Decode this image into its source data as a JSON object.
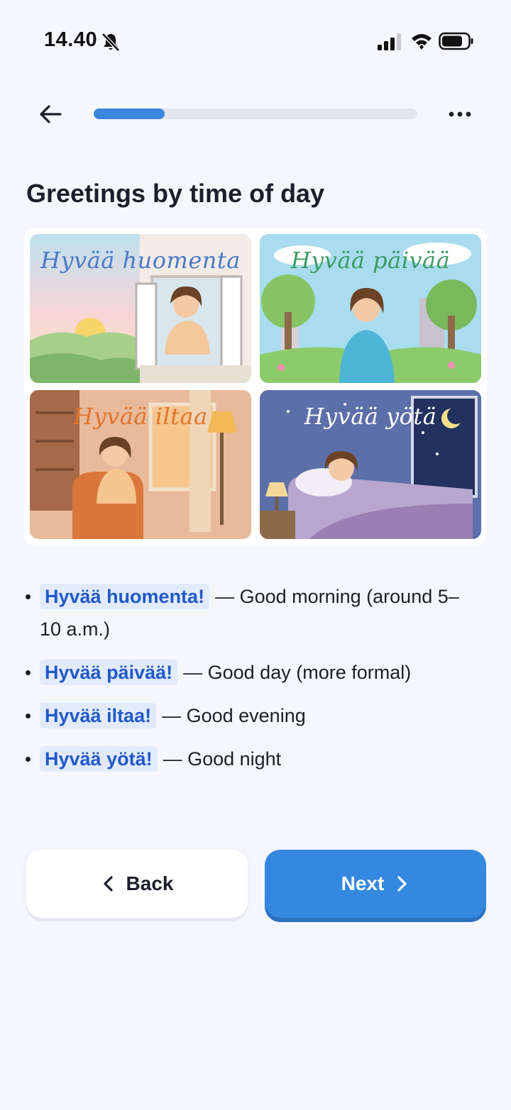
{
  "status_bar": {
    "time": "14.40",
    "icons": [
      "bell-off-icon",
      "signal-icon",
      "wifi-icon",
      "battery-icon"
    ]
  },
  "nav": {
    "back_icon": "arrow-left-icon",
    "progress": 0.22,
    "menu_icon": "more-horizontal-icon"
  },
  "lesson": {
    "title": "Greetings by time of day",
    "illustrations": [
      {
        "label": "Hyvää huomenta",
        "color": "#4a78c8"
      },
      {
        "label": "Hyvää päivää",
        "color": "#3c9a63"
      },
      {
        "label": "Hyvää iltaa",
        "color": "#e0742c"
      },
      {
        "label": "Hyvää yötä",
        "color": "#ffffff"
      }
    ],
    "vocab": [
      {
        "term": "Hyvää huomenta!",
        "meaning": "— Good morning (around 5–10 a.m.)"
      },
      {
        "term": "Hyvää päivää!",
        "meaning": "— Good day (more formal)"
      },
      {
        "term": "Hyvää iltaa!",
        "meaning": "— Good evening"
      },
      {
        "term": "Hyvää yötä!",
        "meaning": "— Good night"
      }
    ]
  },
  "buttons": {
    "back_label": "Back",
    "next_label": "Next"
  },
  "colors": {
    "accent": "#3588e0",
    "term_text": "#2159c9",
    "term_bg": "#e2ebfb",
    "background": "#f5f7fc"
  }
}
